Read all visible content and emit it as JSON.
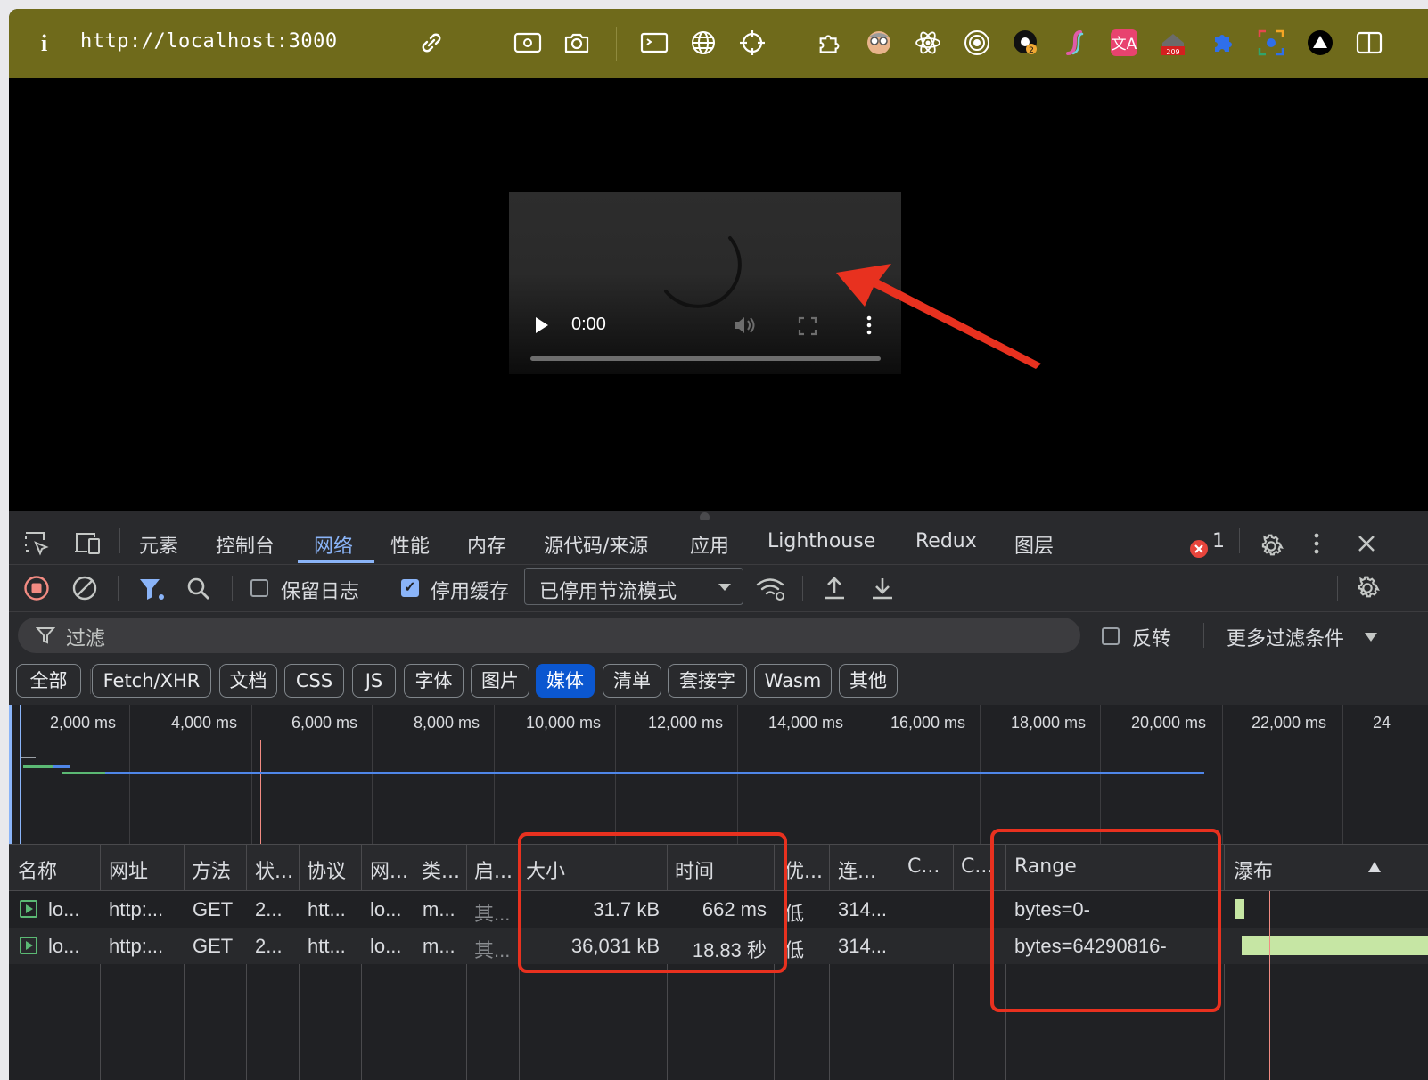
{
  "browser": {
    "info_label": "i",
    "url": "http://localhost:3000"
  },
  "video": {
    "time": "0:00"
  },
  "devtools": {
    "tabs": [
      "元素",
      "控制台",
      "网络",
      "性能",
      "内存",
      "源代码/来源",
      "应用",
      "Lighthouse",
      "Redux",
      "图层"
    ],
    "active_tab": "网络",
    "error_count": "1"
  },
  "network_toolbar": {
    "preserve_log": "保留日志",
    "disable_cache": "停用缓存",
    "throttling": "已停用节流模式"
  },
  "filter": {
    "placeholder": "过滤",
    "invert": "反转",
    "more_filters": "更多过滤条件"
  },
  "type_filters": [
    "全部",
    "Fetch/XHR",
    "文档",
    "CSS",
    "JS",
    "字体",
    "图片",
    "媒体",
    "清单",
    "套接字",
    "Wasm",
    "其他"
  ],
  "active_type_filter": "媒体",
  "timeline": {
    "ticks": [
      "2,000 ms",
      "4,000 ms",
      "6,000 ms",
      "8,000 ms",
      "10,000 ms",
      "12,000 ms",
      "14,000 ms",
      "16,000 ms",
      "18,000 ms",
      "20,000 ms",
      "22,000 ms",
      "24"
    ]
  },
  "table": {
    "columns": [
      "名称",
      "网址",
      "方法",
      "状...",
      "协议",
      "网...",
      "类...",
      "启...",
      "大小",
      "时间",
      "优...",
      "连...",
      "C...",
      "C...",
      "Range",
      "瀑布"
    ],
    "rows": [
      {
        "name": "lo...",
        "url": "http:...",
        "method": "GET",
        "status": "2...",
        "protocol": "htt...",
        "net": "lo...",
        "type": "m...",
        "initiator": "其...",
        "size": "31.7 kB",
        "time": "662 ms",
        "priority": "低",
        "connection": "314...",
        "c1": "",
        "c2": "",
        "range": "bytes=0-"
      },
      {
        "name": "lo...",
        "url": "http:...",
        "method": "GET",
        "status": "2...",
        "protocol": "htt...",
        "net": "lo...",
        "type": "m...",
        "initiator": "其...",
        "size": "36,031 kB",
        "time": "18.83 秒",
        "priority": "低",
        "connection": "314...",
        "c1": "",
        "c2": "",
        "range": "bytes=64290816-"
      }
    ]
  },
  "colors": {
    "browser_bar": "#6f6a1b",
    "accent": "#8ab4f8",
    "annotation_red": "#e8311f",
    "waterfall_bar": "#c6e6a4"
  }
}
